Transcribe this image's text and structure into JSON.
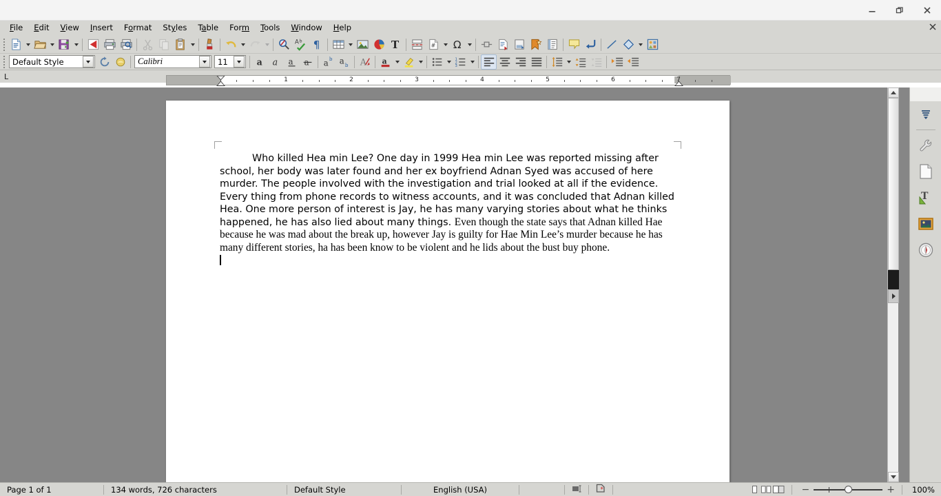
{
  "window": {
    "minimize_label": "–",
    "maximize_label": "❐",
    "close_label": "✕",
    "doc_close_label": "✕"
  },
  "menubar": {
    "items": [
      {
        "label": "File",
        "accel": "F"
      },
      {
        "label": "Edit",
        "accel": "E"
      },
      {
        "label": "View",
        "accel": "V"
      },
      {
        "label": "Insert",
        "accel": "I"
      },
      {
        "label": "Format",
        "accel": "o"
      },
      {
        "label": "Styles",
        "accel": "y"
      },
      {
        "label": "Table",
        "accel": "a"
      },
      {
        "label": "Form",
        "accel": "m"
      },
      {
        "label": "Tools",
        "accel": "T"
      },
      {
        "label": "Window",
        "accel": "W"
      },
      {
        "label": "Help",
        "accel": "H"
      }
    ]
  },
  "standard_toolbar": {
    "buttons": [
      {
        "name": "new-document",
        "label": "New"
      },
      {
        "name": "open-document",
        "label": "Open"
      },
      {
        "name": "save-document",
        "label": "Save"
      },
      {
        "name": "export-pdf",
        "label": "Export as PDF"
      },
      {
        "name": "print",
        "label": "Print"
      },
      {
        "name": "print-preview",
        "label": "Toggle Print Preview"
      },
      {
        "name": "cut",
        "label": "Cut"
      },
      {
        "name": "copy",
        "label": "Copy"
      },
      {
        "name": "paste",
        "label": "Paste"
      },
      {
        "name": "clone-formatting",
        "label": "Clone Formatting"
      },
      {
        "name": "undo",
        "label": "Undo"
      },
      {
        "name": "redo",
        "label": "Redo"
      },
      {
        "name": "find-replace",
        "label": "Find and Replace"
      },
      {
        "name": "spelling",
        "label": "Check Spelling"
      },
      {
        "name": "formatting-marks",
        "label": "Formatting Marks"
      },
      {
        "name": "insert-table",
        "label": "Insert Table"
      },
      {
        "name": "insert-image",
        "label": "Insert Image"
      },
      {
        "name": "insert-chart",
        "label": "Insert Chart"
      },
      {
        "name": "insert-text-box",
        "label": "Insert Text Box"
      },
      {
        "name": "insert-page-break",
        "label": "Insert Page Break"
      },
      {
        "name": "insert-field",
        "label": "Insert Field"
      },
      {
        "name": "special-character",
        "label": "Insert Special Character"
      },
      {
        "name": "insert-section",
        "label": "Insert Section"
      },
      {
        "name": "insert-hyperlink",
        "label": "Insert Hyperlink"
      },
      {
        "name": "insert-footnote",
        "label": "Insert Footnote"
      },
      {
        "name": "insert-bookmark",
        "label": "Insert Bookmark"
      },
      {
        "name": "insert-cross-reference",
        "label": "Insert Cross-reference"
      },
      {
        "name": "insert-comment",
        "label": "Insert Comment"
      },
      {
        "name": "track-changes",
        "label": "Record Track Changes"
      },
      {
        "name": "insert-line",
        "label": "Insert Line"
      },
      {
        "name": "basic-shapes",
        "label": "Basic Shapes"
      },
      {
        "name": "show-draw-functions",
        "label": "Show Draw Functions"
      }
    ]
  },
  "formatting_toolbar": {
    "paragraph_style": "Default Style",
    "font_name": "Calibri",
    "font_size": "11",
    "buttons": [
      {
        "name": "update-style",
        "label": "Update Selected Style"
      },
      {
        "name": "new-style",
        "label": "New Style from Selection"
      },
      {
        "name": "bold",
        "label": "Bold"
      },
      {
        "name": "italic",
        "label": "Italic"
      },
      {
        "name": "underline",
        "label": "Underline"
      },
      {
        "name": "strikethrough",
        "label": "Strikethrough"
      },
      {
        "name": "superscript",
        "label": "Superscript"
      },
      {
        "name": "subscript",
        "label": "Subscript"
      },
      {
        "name": "clear-formatting",
        "label": "Clear Direct Formatting"
      },
      {
        "name": "font-color",
        "label": "Font Color"
      },
      {
        "name": "highlighting-color",
        "label": "Character Highlighting Color"
      },
      {
        "name": "unordered-list",
        "label": "Unordered List"
      },
      {
        "name": "ordered-list",
        "label": "Ordered List"
      },
      {
        "name": "align-left",
        "label": "Align Left",
        "active": true
      },
      {
        "name": "align-center",
        "label": "Align Center"
      },
      {
        "name": "align-right",
        "label": "Align Right"
      },
      {
        "name": "justified",
        "label": "Justified"
      },
      {
        "name": "line-spacing",
        "label": "Set Line Spacing"
      },
      {
        "name": "increase-paragraph-spacing",
        "label": "Increase Paragraph Spacing"
      },
      {
        "name": "decrease-paragraph-spacing",
        "label": "Decrease Paragraph Spacing"
      },
      {
        "name": "increase-indent",
        "label": "Increase Indent"
      },
      {
        "name": "decrease-indent",
        "label": "Decrease Indent"
      }
    ]
  },
  "ruler": {
    "tab_selector": "L",
    "unit": "inch",
    "tick_labels": [
      "1",
      "2",
      "3",
      "4",
      "5",
      "6",
      "7"
    ],
    "left_margin_end_in": 1.0,
    "right_margin_start_in": 7.5,
    "max_in": 8.1
  },
  "document": {
    "paragraph_runs": [
      {
        "style": "sans",
        "text": "Who killed Hea min Lee? One day in 1999 Hea min Lee was reported missing after school, her body was later found and her ex boyfriend Adnan Syed was accused of here murder. The people involved with the investigation and trial looked at all if the evidence. Every thing from phone records to witness accounts, and it was concluded that Adnan killed Hea. One more person of interest is Jay, he has many varying stories about what he thinks happened, he has also lied about many things. "
      },
      {
        "style": "serif",
        "text": "Even though the state says that Adnan killed Hae because he was mad about the break up, however Jay is guilty for Hae Min Lee’s murder because he has many different stories, ha has been know to be violent and he lids about the bust buy phone."
      }
    ],
    "first_line_indent": true,
    "caret_visible": true
  },
  "sidebar": {
    "items": [
      {
        "name": "sidebar-settings",
        "label": "Sidebar Settings"
      },
      {
        "name": "sidebar-properties",
        "label": "Properties"
      },
      {
        "name": "sidebar-page",
        "label": "Page"
      },
      {
        "name": "sidebar-styles",
        "label": "Styles"
      },
      {
        "name": "sidebar-gallery",
        "label": "Gallery"
      },
      {
        "name": "sidebar-navigator",
        "label": "Navigator"
      }
    ]
  },
  "statusbar": {
    "page_info": "Page 1 of 1",
    "word_count": "134 words, 726 characters",
    "page_style": "Default Style",
    "language": "English (USA)",
    "selection_mode": "Standard selection",
    "save_status": "Document has been modified",
    "view_buttons": [
      {
        "name": "single-page-view",
        "label": "Single-page view"
      },
      {
        "name": "multi-page-view",
        "label": "Multiple-page view"
      },
      {
        "name": "book-view",
        "label": "Book view"
      }
    ],
    "zoom_out_label": "−",
    "zoom_in_label": "+",
    "zoom_level": "100%"
  }
}
